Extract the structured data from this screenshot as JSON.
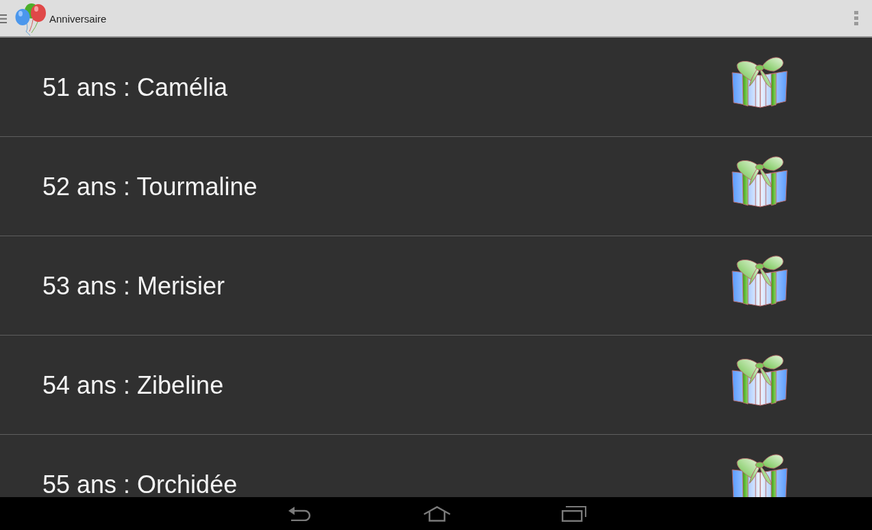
{
  "action_bar": {
    "title": "Anniversaire"
  },
  "rows": [
    {
      "label": "51 ans : Camélia"
    },
    {
      "label": "52 ans : Tourmaline"
    },
    {
      "label": "53 ans : Merisier"
    },
    {
      "label": "54 ans : Zibeline"
    },
    {
      "label": "55 ans : Orchidée"
    }
  ]
}
